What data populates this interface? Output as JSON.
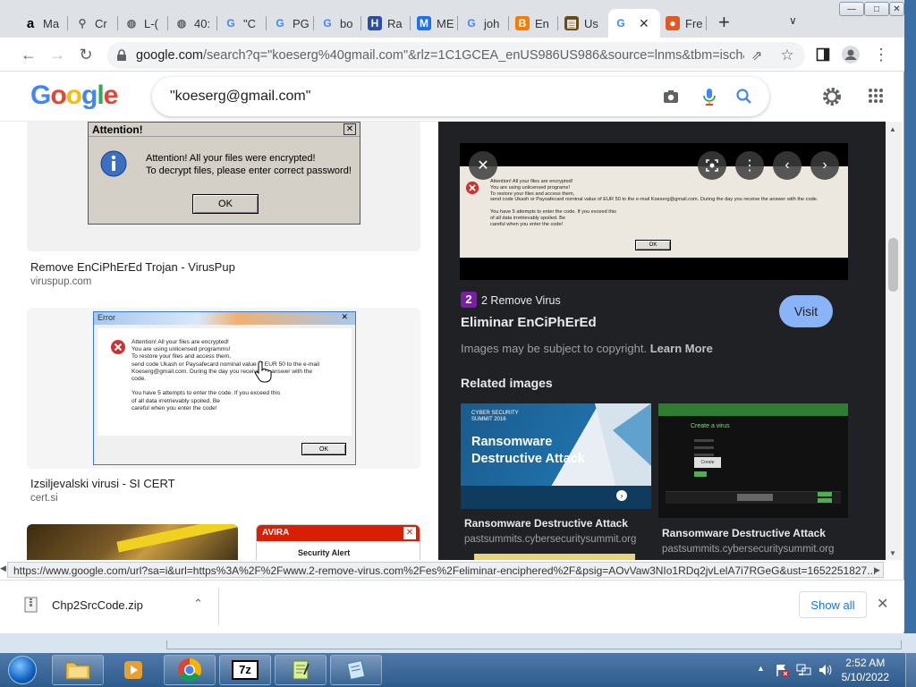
{
  "tabs": [
    {
      "label": "Ma",
      "icon": "amazon-icon",
      "color": "#000000",
      "glyph": "a"
    },
    {
      "label": "Cr",
      "icon": "link-icon",
      "color": "#5f6368",
      "glyph": "⚲"
    },
    {
      "label": "L-(",
      "icon": "globe-icon",
      "color": "#5f6368",
      "glyph": "◍"
    },
    {
      "label": "40:",
      "icon": "globe-icon",
      "color": "#5f6368",
      "glyph": "◍"
    },
    {
      "label": "\"C",
      "icon": "google-icon",
      "color": "#4285f4",
      "glyph": "G"
    },
    {
      "label": "PG",
      "icon": "google-icon",
      "color": "#4285f4",
      "glyph": "G"
    },
    {
      "label": "bo",
      "icon": "google-icon",
      "color": "#4285f4",
      "glyph": "G"
    },
    {
      "label": "Ra",
      "icon": "h-icon",
      "color": "#2b4ea0",
      "glyph": "H"
    },
    {
      "label": "ME",
      "icon": "m-icon",
      "color": "#1a73e8",
      "glyph": "M"
    },
    {
      "label": "joh",
      "icon": "google-icon",
      "color": "#4285f4",
      "glyph": "G"
    },
    {
      "label": "En",
      "icon": "blogger-icon",
      "color": "#f57c00",
      "glyph": "B"
    },
    {
      "label": "Us",
      "icon": "page-icon",
      "color": "#6b4a1a",
      "glyph": "▤"
    },
    {
      "label": "",
      "icon": "google-icon",
      "color": "#4285f4",
      "glyph": "G"
    },
    {
      "label": "Fre",
      "icon": "firefox-icon",
      "color": "#e25822",
      "glyph": "●"
    }
  ],
  "toolbar": {
    "url_host": "google.com",
    "url_rest": "/search?q=\"koeserg%40gmail.com\"&rlz=1C1GCEA_enUS986US986&source=lnms&tbm=isch&s..."
  },
  "search": {
    "logo": "Google",
    "query": "\"koeserg@gmail.com\""
  },
  "results": [
    {
      "title": "Remove EnCiPhErEd Trojan - VirusPup",
      "site": "viruspup.com"
    },
    {
      "title": "Izsiljevalski virusi - SI CERT",
      "site": "cert.si"
    }
  ],
  "dialog1": {
    "title": "Attention!",
    "line1": "Attention! All your files were encrypted!",
    "line2": "To decrypt files, please enter correct password!",
    "ok": "OK"
  },
  "dialog2": {
    "title": "Error",
    "lines": [
      "Attention! All your files are encrypted!",
      "You are using unlicensed programms!",
      "To restore your files and access them,",
      "send code Ukash or Paysafecard nominal value of EUR 50 to the e-mail",
      "Koeserg@gmail.com. During the day you receive the answer with the",
      "code.",
      "",
      "You have 5 attempts to enter the code. If you exceed this",
      "of all data irretrievably spoiled. Be",
      "careful when you enter the code!"
    ],
    "ok": "OK"
  },
  "thumb4": {
    "brand": "AVIRA",
    "label": "Security Alert"
  },
  "panel": {
    "preview_lines": [
      "Attention! All your files are encrypted!",
      "You are using unlicensed programs!",
      "To restore your files and access them,",
      "send code Ukash or Paysafecard nominal value of EUR 50 to the e-mail Koeserg@gmail.com. During the day you receive the answer with the code.",
      "",
      "You have 5 attempts to enter the code. If you exceed this",
      "of all data irretrievably spoiled. Be",
      "careful when you enter the code!"
    ],
    "preview_ok": "OK",
    "source": "2 Remove Virus",
    "title": "Eliminar EnCiPhErEd",
    "visit": "Visit",
    "copyright": "Images may be subject to copyright.",
    "learn_more": "Learn More",
    "related_heading": "Related images",
    "related": [
      {
        "title": "Ransomware Destructive Attack",
        "site": "pastsummits.cybersecuritysummit.org",
        "thumb_line1": "Ransomware",
        "thumb_line2": "Destructive Attack",
        "thumb_brand": "CYBER SECURITY SUMMIT 2016"
      },
      {
        "title": "Ransomware Destructive Attack",
        "site": "pastsummits.cybersecuritysummit.org",
        "thumb_heading": "Create a virus",
        "thumb_button": "Create"
      }
    ]
  },
  "statusbar": {
    "url": "https://www.google.com/url?sa=i&url=https%3A%2F%2Fwww.2-remove-virus.com%2Fes%2Feliminar-enciphered%2F&psig=AOvVaw3NIo1RDq2jvLelA7i7RGeG&ust=1652251827..."
  },
  "downloads": {
    "file": "Chp2SrcCode.zip",
    "show_all": "Show all"
  },
  "taskbar": {
    "time": "2:52 AM",
    "date": "5/10/2022"
  }
}
